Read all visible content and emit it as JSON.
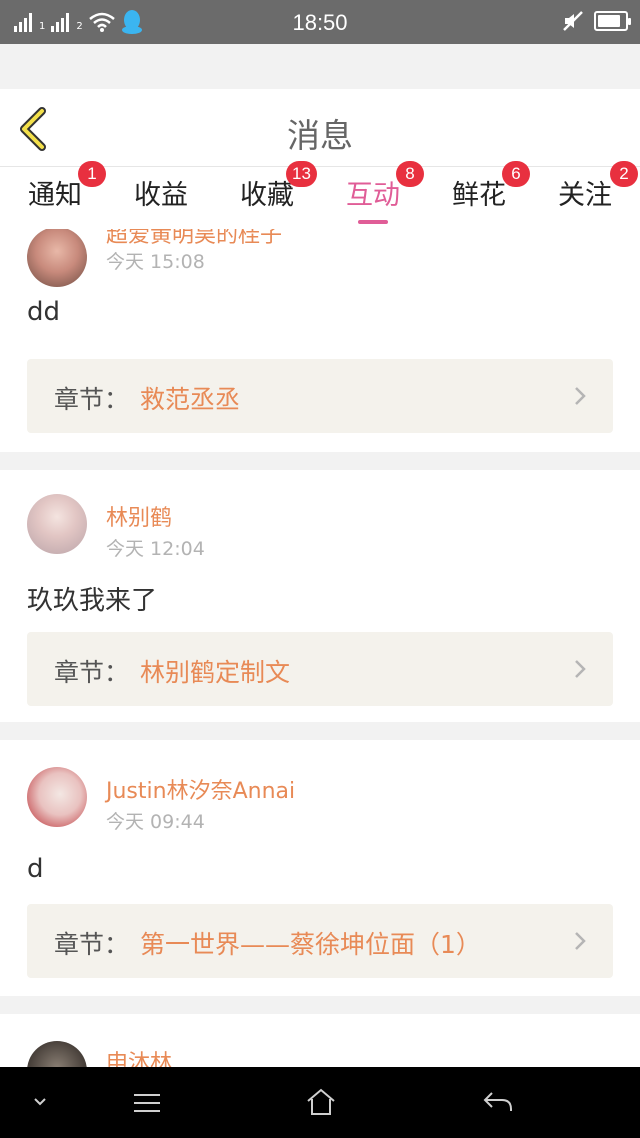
{
  "status_bar": {
    "time": "18:50",
    "sim1": "1",
    "sim2": "2",
    "battery_level": 0.85
  },
  "header": {
    "title": "消息",
    "back_icon": "chevron-left-icon"
  },
  "tabs": [
    {
      "label": "通知",
      "badge": "1",
      "active": false
    },
    {
      "label": "收益",
      "badge": "",
      "active": false
    },
    {
      "label": "收藏",
      "badge": "13",
      "active": false
    },
    {
      "label": "互动",
      "badge": "8",
      "active": true
    },
    {
      "label": "鲜花",
      "badge": "6",
      "active": false
    },
    {
      "label": "关注",
      "badge": "2",
      "active": false
    }
  ],
  "colors": {
    "accent_pink": "#e05d97",
    "name_orange": "#e88a56",
    "badge_red": "#e8303f",
    "chapter_bg": "#f4f2ec"
  },
  "messages": [
    {
      "username": "超爱黄明昊的桂子",
      "time": "今天 15:08",
      "content": "dd",
      "chapter_label": "章节：",
      "chapter_name": "救范丞丞"
    },
    {
      "username": "林别鹤",
      "time": "今天 12:04",
      "content": "玖玖我来了",
      "chapter_label": "章节：",
      "chapter_name": "林别鹤定制文"
    },
    {
      "username": "Justin林汐奈Annai",
      "time": "今天 09:44",
      "content": "d",
      "chapter_label": "章节：",
      "chapter_name": "第一世界——蔡徐坤位面（1）"
    },
    {
      "username": "申沐林.",
      "time": "",
      "content": "",
      "chapter_label": "",
      "chapter_name": ""
    }
  ],
  "nav_bar": {
    "icons": [
      "chevron-down-icon",
      "menu-icon",
      "home-icon",
      "back-arrow-icon"
    ]
  }
}
